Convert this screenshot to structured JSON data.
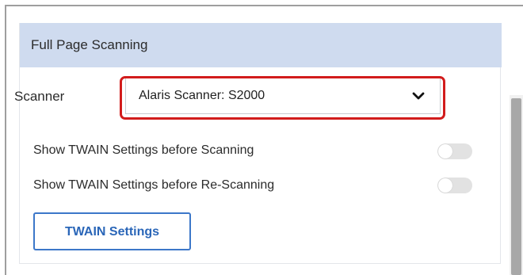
{
  "panel": {
    "title": "Full Page Scanning"
  },
  "scanner": {
    "label": "Scanner",
    "selected_value": "Alaris Scanner: S2000",
    "dropdown_icon": "chevron-down-icon",
    "highlight_color": "#d21c1c"
  },
  "settings": [
    {
      "label": "Show TWAIN Settings before Scanning",
      "enabled": false
    },
    {
      "label": "Show TWAIN Settings before Re-Scanning",
      "enabled": false
    }
  ],
  "twain_button": {
    "label": "TWAIN Settings"
  },
  "colors": {
    "header_background": "#cfdbef",
    "accent": "#3c77c9"
  }
}
